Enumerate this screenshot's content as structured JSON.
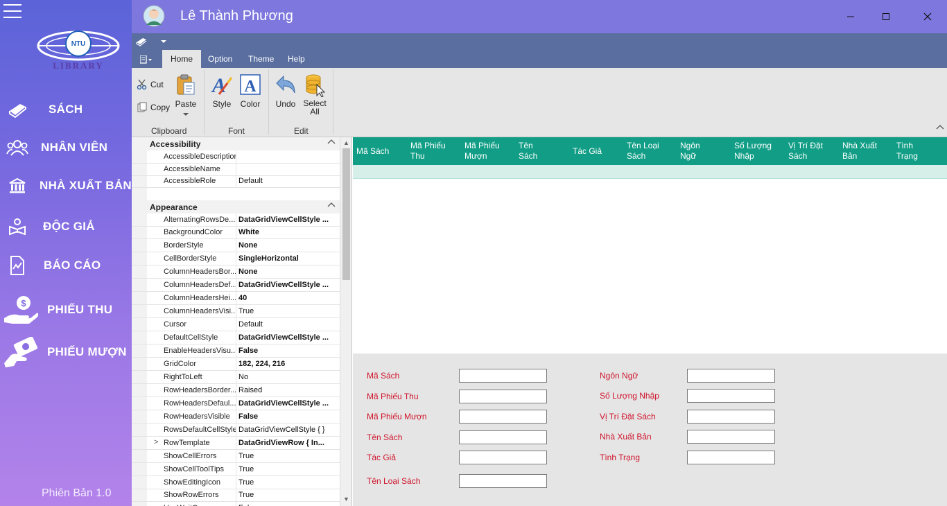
{
  "app": {
    "user_name": "Lê Thành Phương",
    "version": "Phiên Bản 1.0",
    "logo_top_text": "NTU",
    "logo_bottom_text": "LIBRARY"
  },
  "sidebar": {
    "items": [
      {
        "label": "SÁCH",
        "icon": "book-icon"
      },
      {
        "label": "NHÂN VIÊN",
        "icon": "users-icon"
      },
      {
        "label": "NHÀ XUẤT BẢN",
        "icon": "bank-icon"
      },
      {
        "label": "ĐỘC GIẢ",
        "icon": "reader-icon"
      },
      {
        "label": "BÁO CÁO",
        "icon": "report-icon"
      },
      {
        "label": "PHIẾU THU",
        "icon": "money-hand-icon"
      },
      {
        "label": "PHIẾU MƯỢN",
        "icon": "borrow-card-icon"
      }
    ]
  },
  "ribbon": {
    "tabs": [
      "Home",
      "Option",
      "Theme",
      "Help"
    ],
    "active_tab": "Home",
    "clipboard": {
      "cut": "Cut",
      "copy": "Copy",
      "paste": "Paste",
      "group": "Clipboard"
    },
    "font": {
      "style": "Style",
      "color": "Color",
      "group": "Font"
    },
    "edit": {
      "undo": "Undo",
      "select_all_1": "Select",
      "select_all_2": "All",
      "group": "Edit"
    }
  },
  "property_grid": {
    "categories": [
      {
        "name": "Accessibility",
        "rows": [
          {
            "name": "AccessibleDescription",
            "value": "",
            "bold": false
          },
          {
            "name": "AccessibleName",
            "value": "",
            "bold": false
          },
          {
            "name": "AccessibleRole",
            "value": "Default",
            "bold": false
          }
        ]
      },
      {
        "name": "Appearance",
        "rows": [
          {
            "name": "AlternatingRowsDe...",
            "value": "DataGridViewCellStyle ...",
            "bold": true
          },
          {
            "name": "BackgroundColor",
            "value": "White",
            "bold": true
          },
          {
            "name": "BorderStyle",
            "value": "None",
            "bold": true
          },
          {
            "name": "CellBorderStyle",
            "value": "SingleHorizontal",
            "bold": true
          },
          {
            "name": "ColumnHeadersBor...",
            "value": "None",
            "bold": true
          },
          {
            "name": "ColumnHeadersDef...",
            "value": "DataGridViewCellStyle ...",
            "bold": true
          },
          {
            "name": "ColumnHeadersHei...",
            "value": "40",
            "bold": true
          },
          {
            "name": "ColumnHeadersVisi...",
            "value": "True",
            "bold": false
          },
          {
            "name": "Cursor",
            "value": "Default",
            "bold": false
          },
          {
            "name": "DefaultCellStyle",
            "value": "DataGridViewCellStyle ...",
            "bold": true
          },
          {
            "name": "EnableHeadersVisu...",
            "value": "False",
            "bold": true
          },
          {
            "name": "GridColor",
            "value": "182, 224, 216",
            "bold": true
          },
          {
            "name": "RightToLeft",
            "value": "No",
            "bold": false
          },
          {
            "name": "RowHeadersBorder...",
            "value": "Raised",
            "bold": false
          },
          {
            "name": "RowHeadersDefaul...",
            "value": "DataGridViewCellStyle ...",
            "bold": true
          },
          {
            "name": "RowHeadersVisible",
            "value": "False",
            "bold": true
          },
          {
            "name": "RowsDefaultCellStyle",
            "value": "DataGridViewCellStyle { }",
            "bold": false
          },
          {
            "name": "RowTemplate",
            "value": "DataGridViewRow { In...",
            "bold": true,
            "expandable": true
          },
          {
            "name": "ShowCellErrors",
            "value": "True",
            "bold": false
          },
          {
            "name": "ShowCellToolTips",
            "value": "True",
            "bold": false
          },
          {
            "name": "ShowEditingIcon",
            "value": "True",
            "bold": false
          },
          {
            "name": "ShowRowErrors",
            "value": "True",
            "bold": false
          },
          {
            "name": "UseWaitCursor",
            "value": "False",
            "bold": false
          }
        ]
      }
    ]
  },
  "grid": {
    "header_color": "#129e86",
    "row_color": "#d7efe9",
    "columns": [
      [
        "Mã Sách"
      ],
      [
        "Mã Phiếu",
        "Thu"
      ],
      [
        "Mã Phiếu",
        "Mượn"
      ],
      [
        "Tên",
        "Sách"
      ],
      [
        "Tác Giả"
      ],
      [
        "Tên Loại",
        "Sách"
      ],
      [
        "Ngôn",
        "Ngữ"
      ],
      [
        "Số Lượng",
        "Nhập"
      ],
      [
        "Vị Trí Đặt",
        "Sách"
      ],
      [
        "Nhà Xuất",
        "Bản"
      ],
      [
        "Tình",
        "Trạng"
      ]
    ]
  },
  "form": {
    "label_color": "#d0142c",
    "left_fields": [
      {
        "label": "Mã Sách",
        "value": ""
      },
      {
        "label": "Mã Phiếu Thu",
        "value": ""
      },
      {
        "label": "Mã Phiếu Mượn",
        "value": ""
      },
      {
        "label": "Tên Sách",
        "value": ""
      },
      {
        "label": "Tác Giả",
        "value": ""
      },
      {
        "label": "Tên Loại Sách",
        "value": ""
      }
    ],
    "right_fields": [
      {
        "label": "Ngôn Ngữ",
        "value": ""
      },
      {
        "label": "Số Lượng Nhập",
        "value": ""
      },
      {
        "label": "Vị Trí Đặt Sách",
        "value": ""
      },
      {
        "label": "Nhà Xuất Bản",
        "value": ""
      },
      {
        "label": "Tình Trạng",
        "value": ""
      }
    ]
  }
}
